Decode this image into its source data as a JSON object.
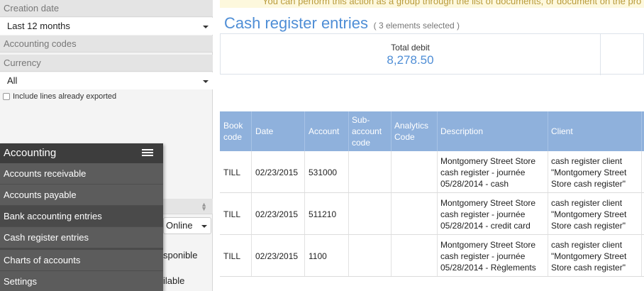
{
  "filters": {
    "creation_date": {
      "label": "Creation date",
      "value": "Last 12 months"
    },
    "accounting_codes": {
      "label": "Accounting codes"
    },
    "currency": {
      "label": "Currency",
      "value": "All"
    },
    "include_exported": {
      "label": "Include lines already exported",
      "checked": false
    },
    "status_select": {
      "value": "Online"
    },
    "partial_text_1": "sponible",
    "partial_text_2": "ilable"
  },
  "menu": {
    "title": "Accounting",
    "icon": "list-icon",
    "items": [
      {
        "label": "Accounts receivable"
      },
      {
        "label": "Accounts payable"
      },
      {
        "label": "Bank accounting entries"
      },
      {
        "label": "Cash register entries"
      },
      {
        "label": "Charts of accounts"
      },
      {
        "label": "Settings"
      }
    ]
  },
  "banner": {
    "text": "You can perform this action as a group through the list of documents, or document on the pro"
  },
  "page": {
    "title": "Cash register entries",
    "subtitle": "( 3 elements selected )"
  },
  "totals": {
    "label": "Total debit",
    "value": "8,278.50"
  },
  "table": {
    "columns": [
      "Book code",
      "Date",
      "Account",
      "Sub-account code",
      "Analytics Code",
      "Description",
      "Client"
    ],
    "rows": [
      {
        "book": "TILL",
        "date": "02/23/2015",
        "account": "531000",
        "sub": "",
        "analytics": "",
        "description": "Montgomery Street Store cash register - journée 05/28/2014 - cash",
        "client": "cash register client \"Montgomery Street Store cash register\""
      },
      {
        "book": "TILL",
        "date": "02/23/2015",
        "account": "511210",
        "sub": "",
        "analytics": "",
        "description": "Montgomery Street Store cash register - journée 05/28/2014 - credit card",
        "client": "cash register client \"Montgomery Street Store cash register\""
      },
      {
        "book": "TILL",
        "date": "02/23/2015",
        "account": "1100",
        "sub": "",
        "analytics": "",
        "description": "Montgomery Street Store cash register - journée 05/28/2014 - Règlements",
        "client": "cash register client \"Montgomery Street Store cash register\""
      }
    ]
  },
  "colors": {
    "accent": "#4f8ed6",
    "table_header": "#8fb1dc",
    "menu_bg": "#5c5c5c",
    "menu_head": "#3d3d3d"
  }
}
